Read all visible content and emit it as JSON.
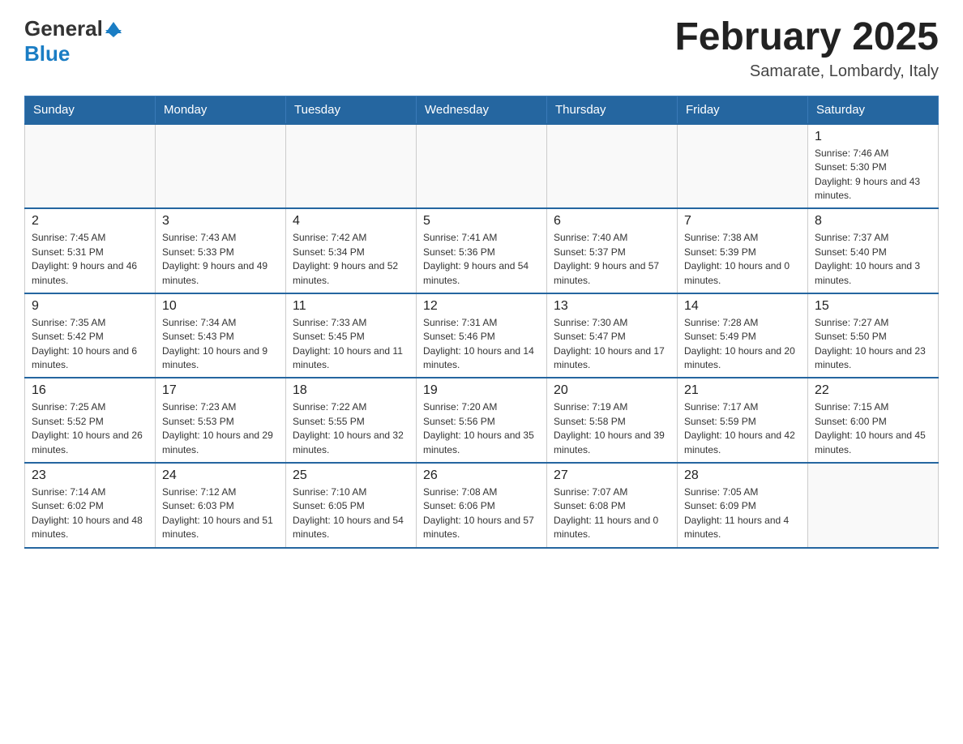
{
  "header": {
    "logo_general": "General",
    "logo_blue": "Blue",
    "month_title": "February 2025",
    "location": "Samarate, Lombardy, Italy"
  },
  "days_of_week": [
    "Sunday",
    "Monday",
    "Tuesday",
    "Wednesday",
    "Thursday",
    "Friday",
    "Saturday"
  ],
  "weeks": [
    [
      {
        "day": "",
        "info": ""
      },
      {
        "day": "",
        "info": ""
      },
      {
        "day": "",
        "info": ""
      },
      {
        "day": "",
        "info": ""
      },
      {
        "day": "",
        "info": ""
      },
      {
        "day": "",
        "info": ""
      },
      {
        "day": "1",
        "info": "Sunrise: 7:46 AM\nSunset: 5:30 PM\nDaylight: 9 hours and 43 minutes."
      }
    ],
    [
      {
        "day": "2",
        "info": "Sunrise: 7:45 AM\nSunset: 5:31 PM\nDaylight: 9 hours and 46 minutes."
      },
      {
        "day": "3",
        "info": "Sunrise: 7:43 AM\nSunset: 5:33 PM\nDaylight: 9 hours and 49 minutes."
      },
      {
        "day": "4",
        "info": "Sunrise: 7:42 AM\nSunset: 5:34 PM\nDaylight: 9 hours and 52 minutes."
      },
      {
        "day": "5",
        "info": "Sunrise: 7:41 AM\nSunset: 5:36 PM\nDaylight: 9 hours and 54 minutes."
      },
      {
        "day": "6",
        "info": "Sunrise: 7:40 AM\nSunset: 5:37 PM\nDaylight: 9 hours and 57 minutes."
      },
      {
        "day": "7",
        "info": "Sunrise: 7:38 AM\nSunset: 5:39 PM\nDaylight: 10 hours and 0 minutes."
      },
      {
        "day": "8",
        "info": "Sunrise: 7:37 AM\nSunset: 5:40 PM\nDaylight: 10 hours and 3 minutes."
      }
    ],
    [
      {
        "day": "9",
        "info": "Sunrise: 7:35 AM\nSunset: 5:42 PM\nDaylight: 10 hours and 6 minutes."
      },
      {
        "day": "10",
        "info": "Sunrise: 7:34 AM\nSunset: 5:43 PM\nDaylight: 10 hours and 9 minutes."
      },
      {
        "day": "11",
        "info": "Sunrise: 7:33 AM\nSunset: 5:45 PM\nDaylight: 10 hours and 11 minutes."
      },
      {
        "day": "12",
        "info": "Sunrise: 7:31 AM\nSunset: 5:46 PM\nDaylight: 10 hours and 14 minutes."
      },
      {
        "day": "13",
        "info": "Sunrise: 7:30 AM\nSunset: 5:47 PM\nDaylight: 10 hours and 17 minutes."
      },
      {
        "day": "14",
        "info": "Sunrise: 7:28 AM\nSunset: 5:49 PM\nDaylight: 10 hours and 20 minutes."
      },
      {
        "day": "15",
        "info": "Sunrise: 7:27 AM\nSunset: 5:50 PM\nDaylight: 10 hours and 23 minutes."
      }
    ],
    [
      {
        "day": "16",
        "info": "Sunrise: 7:25 AM\nSunset: 5:52 PM\nDaylight: 10 hours and 26 minutes."
      },
      {
        "day": "17",
        "info": "Sunrise: 7:23 AM\nSunset: 5:53 PM\nDaylight: 10 hours and 29 minutes."
      },
      {
        "day": "18",
        "info": "Sunrise: 7:22 AM\nSunset: 5:55 PM\nDaylight: 10 hours and 32 minutes."
      },
      {
        "day": "19",
        "info": "Sunrise: 7:20 AM\nSunset: 5:56 PM\nDaylight: 10 hours and 35 minutes."
      },
      {
        "day": "20",
        "info": "Sunrise: 7:19 AM\nSunset: 5:58 PM\nDaylight: 10 hours and 39 minutes."
      },
      {
        "day": "21",
        "info": "Sunrise: 7:17 AM\nSunset: 5:59 PM\nDaylight: 10 hours and 42 minutes."
      },
      {
        "day": "22",
        "info": "Sunrise: 7:15 AM\nSunset: 6:00 PM\nDaylight: 10 hours and 45 minutes."
      }
    ],
    [
      {
        "day": "23",
        "info": "Sunrise: 7:14 AM\nSunset: 6:02 PM\nDaylight: 10 hours and 48 minutes."
      },
      {
        "day": "24",
        "info": "Sunrise: 7:12 AM\nSunset: 6:03 PM\nDaylight: 10 hours and 51 minutes."
      },
      {
        "day": "25",
        "info": "Sunrise: 7:10 AM\nSunset: 6:05 PM\nDaylight: 10 hours and 54 minutes."
      },
      {
        "day": "26",
        "info": "Sunrise: 7:08 AM\nSunset: 6:06 PM\nDaylight: 10 hours and 57 minutes."
      },
      {
        "day": "27",
        "info": "Sunrise: 7:07 AM\nSunset: 6:08 PM\nDaylight: 11 hours and 0 minutes."
      },
      {
        "day": "28",
        "info": "Sunrise: 7:05 AM\nSunset: 6:09 PM\nDaylight: 11 hours and 4 minutes."
      },
      {
        "day": "",
        "info": ""
      }
    ]
  ]
}
